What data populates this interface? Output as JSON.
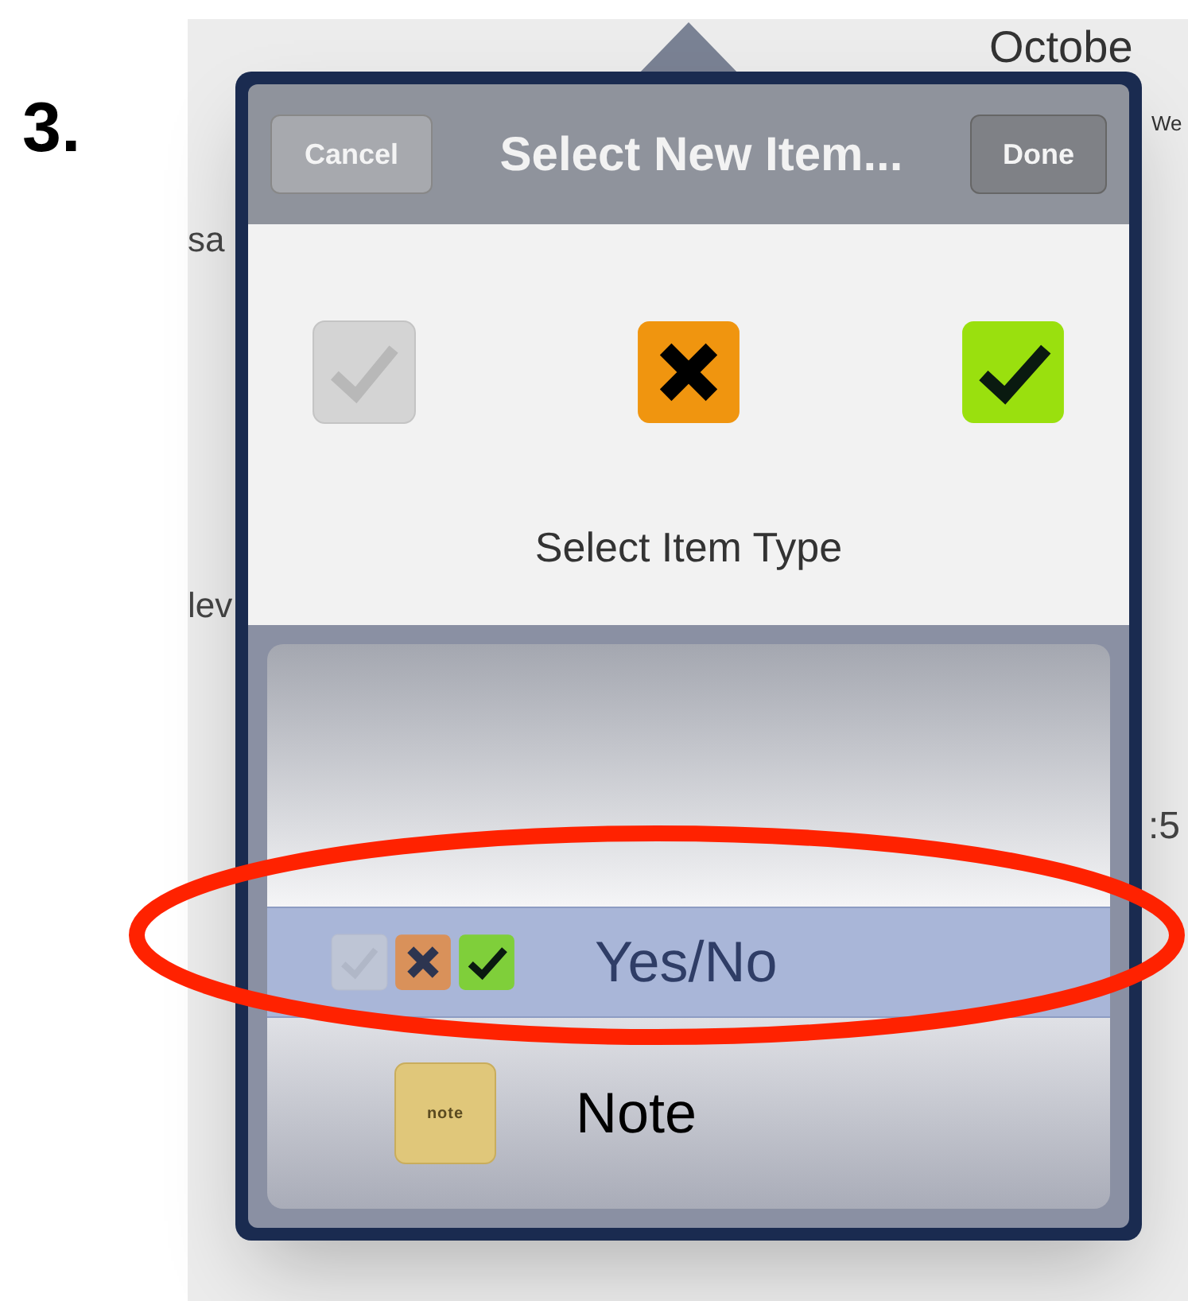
{
  "step_label": "3.",
  "background": {
    "month_title": "Octobe",
    "weekday": "We",
    "left_fragments": [
      "sa",
      "lev"
    ],
    "time_fragment": ":5"
  },
  "popover": {
    "cancel_button": "Cancel",
    "title": "Select New Item...",
    "done_button": "Done",
    "type_caption": "Select Item Type",
    "type_icons": [
      {
        "kind": "unchecked"
      },
      {
        "kind": "no"
      },
      {
        "kind": "yes"
      }
    ],
    "picker": [
      {
        "kind": "yesno",
        "label": "Yes/No",
        "selected": true
      },
      {
        "kind": "note",
        "label": "Note",
        "icon_text": "note",
        "selected": false
      }
    ]
  }
}
